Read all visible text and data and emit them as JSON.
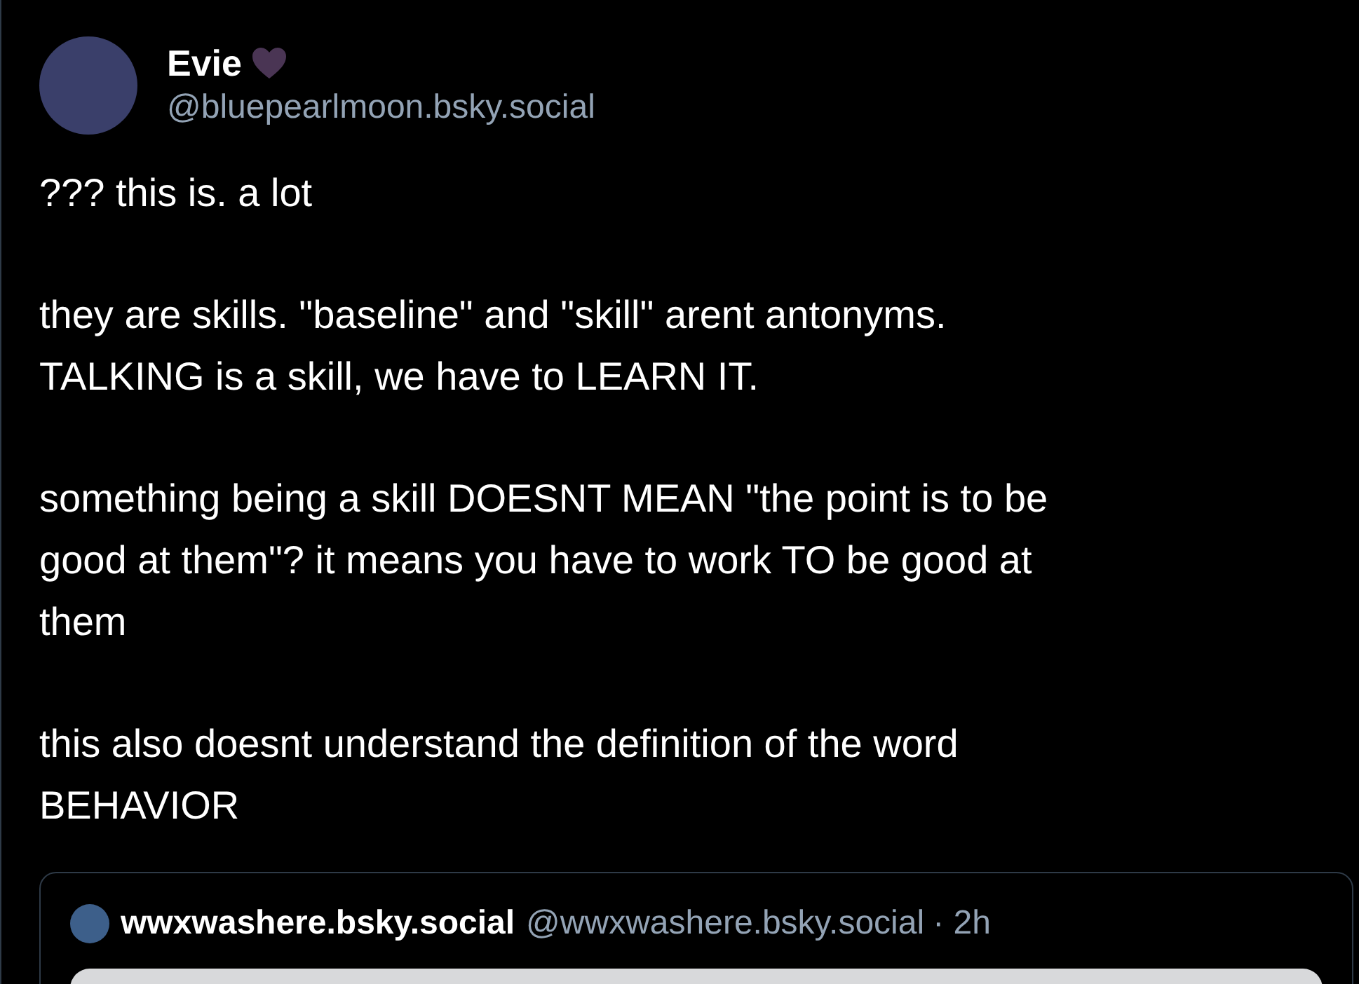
{
  "author": {
    "name": "Evie",
    "handle": "@bluepearlmoon.bsky.social"
  },
  "paragraphs": [
    {
      "lines": [
        "??? this is. a lot"
      ]
    },
    {
      "lines": [
        "they are skills. \"baseline\" and \"skill\" arent antonyms.",
        "TALKING is a skill, we have to LEARN IT."
      ]
    },
    {
      "lines": [
        "something being a skill DOESNT MEAN \"the point is to be",
        "good at them\"? it means you have to work TO be good at",
        "them"
      ]
    },
    {
      "lines": [
        "this also doesnt understand the definition of the word",
        "BEHAVIOR"
      ]
    }
  ],
  "quote": {
    "name": "wwxwashere.bsky.social",
    "handle": "@wwxwashere.bsky.social",
    "time": "· 2h"
  }
}
